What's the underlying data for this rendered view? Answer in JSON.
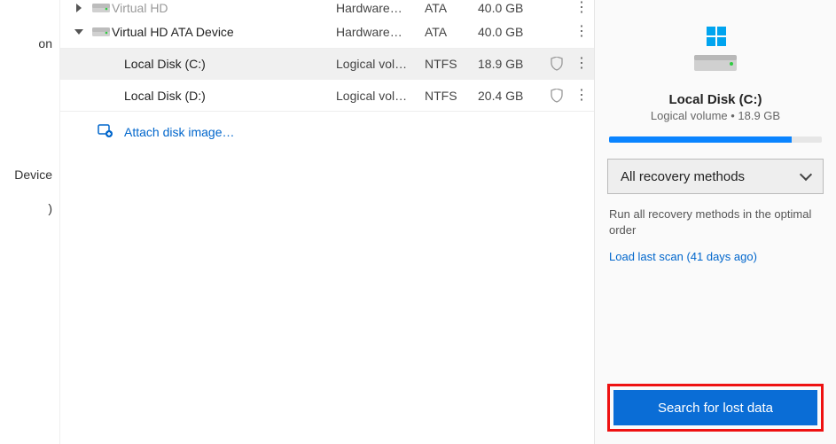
{
  "sidebar": {
    "items": [
      "on",
      "Device",
      ")"
    ]
  },
  "table": {
    "rows": [
      {
        "expand": "right",
        "icon": "hdd",
        "name": "Virtual HD",
        "type": "Hardware…",
        "fs": "ATA",
        "size": "40.0 GB",
        "shield": false,
        "menu": true,
        "indent": 0,
        "cut": true
      },
      {
        "expand": "down",
        "icon": "hdd",
        "name": "Virtual HD ATA Device",
        "type": "Hardware…",
        "fs": "ATA",
        "size": "40.0 GB",
        "shield": false,
        "menu": true,
        "indent": 0
      },
      {
        "expand": "",
        "icon": "vol",
        "name": "Local Disk (C:)",
        "type": "Logical vol…",
        "fs": "NTFS",
        "size": "18.9 GB",
        "shield": true,
        "menu": true,
        "indent": 1,
        "selected": true,
        "topsep": true
      },
      {
        "expand": "",
        "icon": "vol",
        "name": "Local Disk (D:)",
        "type": "Logical vol…",
        "fs": "NTFS",
        "size": "20.4 GB",
        "shield": true,
        "menu": true,
        "indent": 1,
        "sep": true
      }
    ],
    "attach_label": "Attach disk image…"
  },
  "right": {
    "title": "Local Disk (C:)",
    "subtitle": "Logical volume • 18.9 GB",
    "progress_pct": 86,
    "dropdown_label": "All recovery methods",
    "helper": "Run all recovery methods in the optimal order",
    "link": "Load last scan (41 days ago)",
    "cta": "Search for lost data"
  },
  "colors": {
    "accent": "#0a6dd6",
    "highlight_border": "#e11"
  }
}
